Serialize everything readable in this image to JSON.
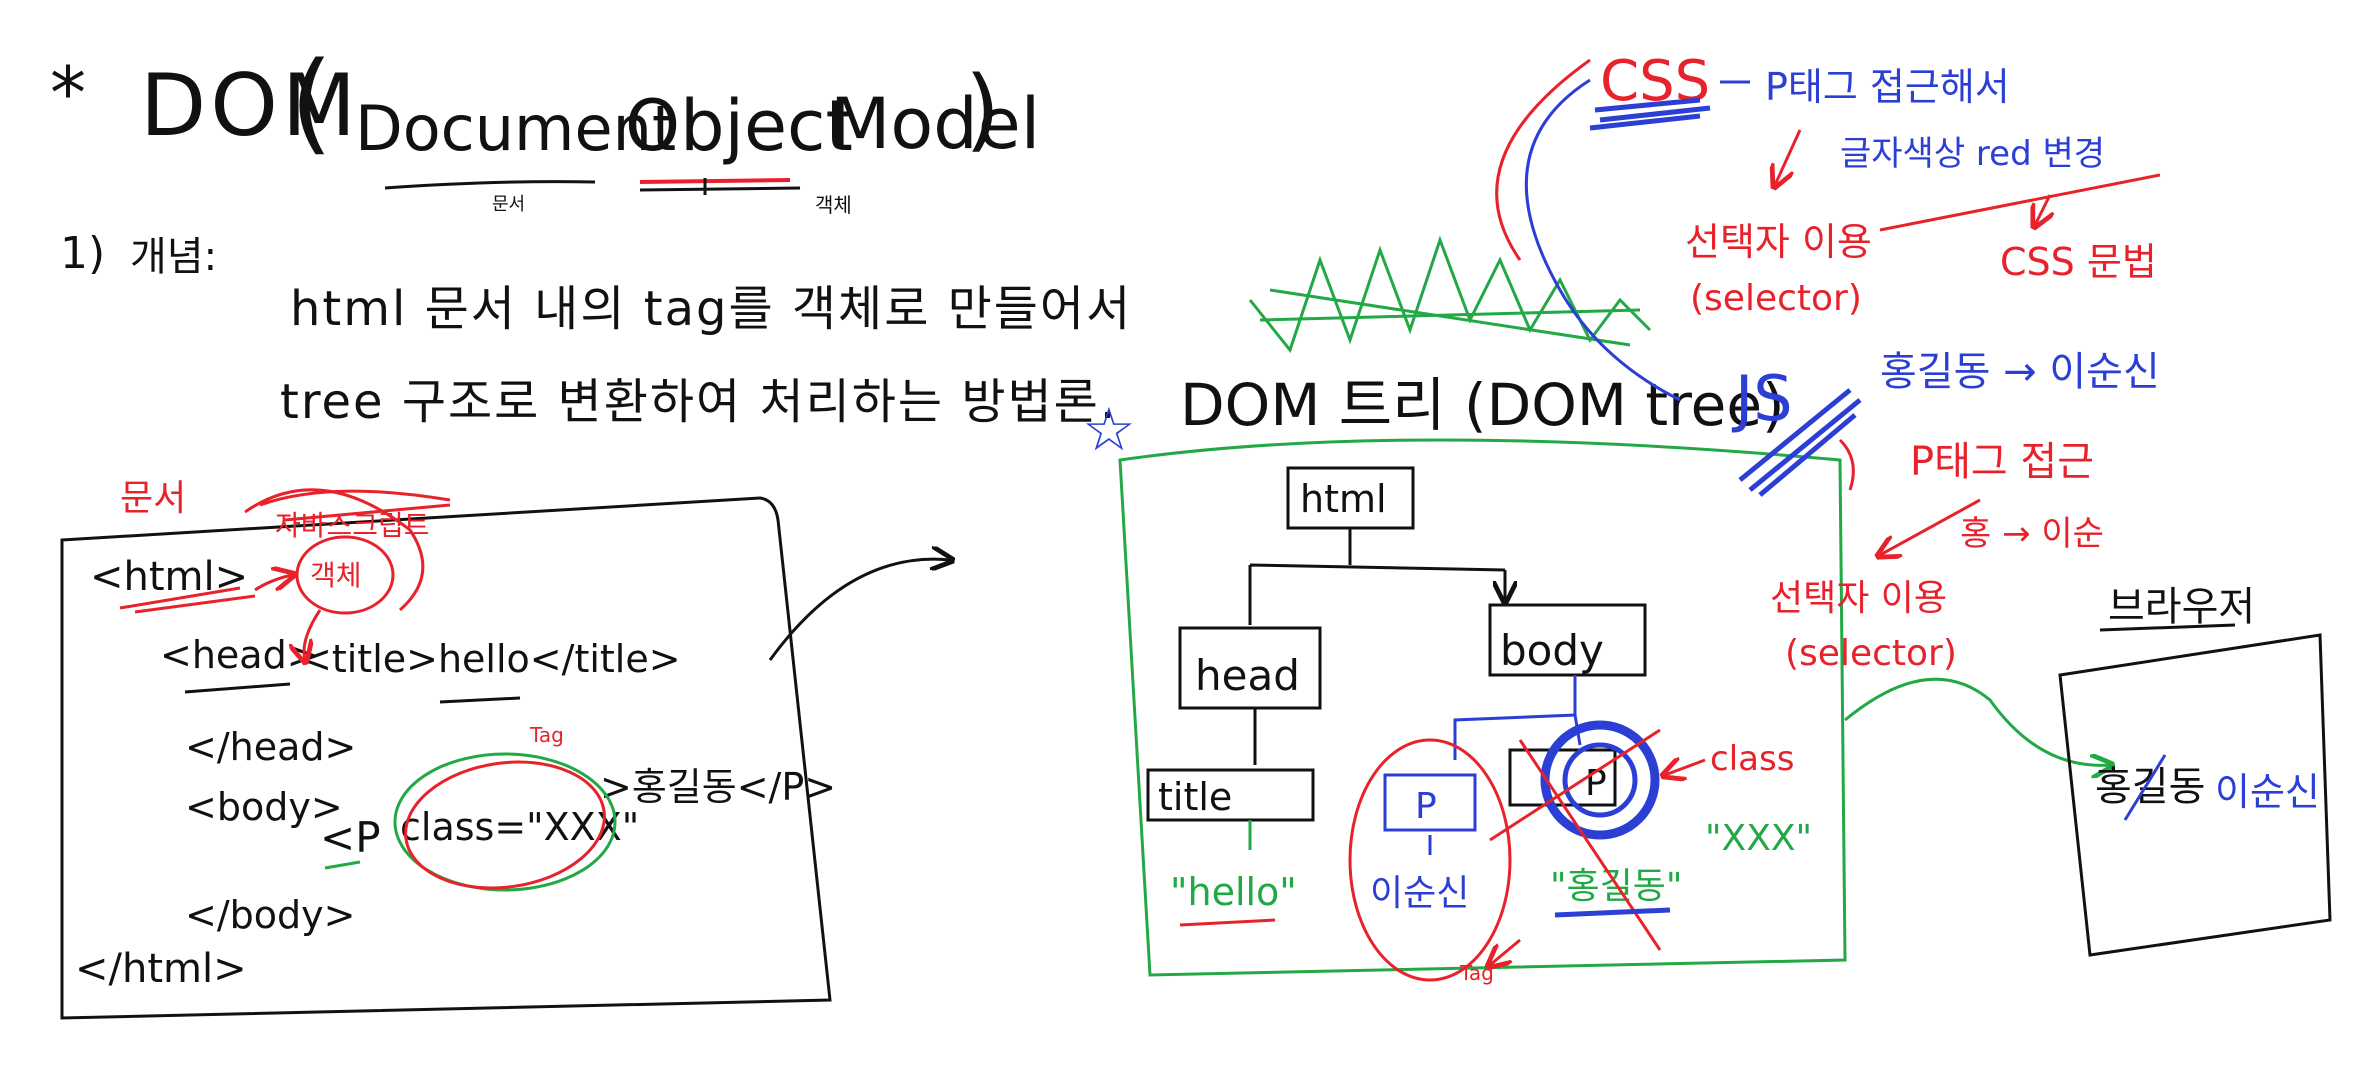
{
  "title": {
    "star": "*",
    "dom": "DOM",
    "open_paren": "(",
    "document": "Document",
    "object": "Object",
    "model": "Model",
    "close_paren": ")",
    "sub_document": "문서",
    "sub_object": "객체"
  },
  "concept": {
    "number": "1)",
    "label": "개념:",
    "line1": "html 문서 내의 tag를 객체로 만들어서",
    "line2": "tree 구조로 변환하여 처리하는 방법론."
  },
  "code_box": {
    "line_html": "<html>",
    "line_head": "<head>",
    "line_title": "<title>hello</title>",
    "line_head_close": "</head>",
    "line_body": "<body>",
    "line_p_open": "<P",
    "line_p_attr": "class=\"XXX\"",
    "line_p_close": ">홍길동</P>",
    "line_body_close": "</body>",
    "line_html_close": "</html>",
    "note_red_1": "문서",
    "note_red_2": "자바스크립트",
    "note_red_circle": "객체",
    "note_red_small": "Tag"
  },
  "dom_tree": {
    "star": "☆",
    "heading": "DOM 트리 (DOM tree)",
    "node_html": "html",
    "node_head": "head",
    "node_body": "body",
    "node_title": "title",
    "node_p1": "P",
    "node_p2": "P",
    "text_hello": "\"hello\"",
    "text_lee": "이순신",
    "text_hong": "\"홍길동\"",
    "attr_class": "class",
    "attr_value": "\"XXX\"",
    "small_red": "Tag"
  },
  "right_notes": {
    "css": "CSS",
    "css_blue": "P태그 접근해서",
    "css_blue2": "글자색상 red 변경",
    "selector_1": "선택자 이용",
    "selector_1b": "(selector)",
    "css_grammar": "CSS 문법",
    "js": "JS",
    "js_blue": "홍길동 → 이순신",
    "js_red": "P태그 접근",
    "js_red2": "홍 → 이순",
    "selector_2": "선택자 이용",
    "selector_2b": "(selector)"
  },
  "result_box": {
    "label": "브라우저",
    "strike_text": "홍길동",
    "new_text": "이순신"
  },
  "colors": {
    "black": "#111111",
    "red": "#e8222b",
    "blue": "#2b3fd4",
    "green": "#22a845"
  }
}
